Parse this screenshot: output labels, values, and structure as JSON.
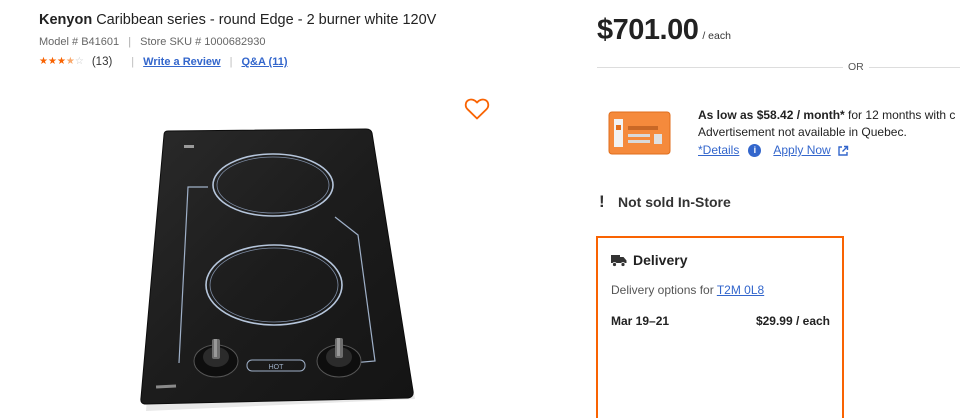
{
  "product": {
    "brand": "Kenyon",
    "title_rest": "Caribbean series - round Edge - 2 burner white 120V",
    "model_label": "Model # B41601",
    "sku_label": "Store SKU # 1000682930",
    "rating": 3.5,
    "rating_max": 5,
    "review_count": "(13)",
    "write_review": "Write a Review",
    "qa": "Q&A (11)",
    "cooktop_label": "HOT"
  },
  "pricing": {
    "price": "$701.00",
    "unit": "/ each",
    "or_text": "OR",
    "finance_prefix": "As low as ",
    "finance_amount": "$58.42 / month*",
    "finance_suffix": " for 12 months with c",
    "finance_note": "Advertisement not available in Quebec.",
    "details_link": "*Details",
    "apply_link": "Apply Now"
  },
  "availability": {
    "instore_label": "Not sold In-Store"
  },
  "delivery": {
    "title": "Delivery",
    "options_prefix": "Delivery options for ",
    "postal_code": "T2M 0L8",
    "date": "Mar 19–21",
    "price": "$29.99 / each"
  },
  "colors": {
    "accent": "#f96302",
    "link": "#3366cc"
  },
  "icons": {
    "favorite": "heart-icon",
    "info": "info-icon",
    "external": "external-link-icon",
    "truck": "truck-icon",
    "card": "credit-card-icon",
    "alert": "exclamation-icon"
  }
}
